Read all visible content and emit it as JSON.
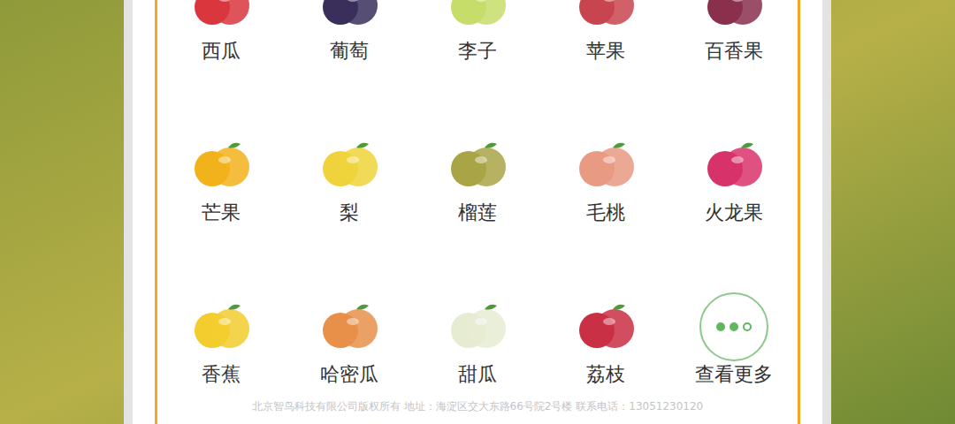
{
  "fruits": [
    {
      "name": "西瓜",
      "kind": "fruit",
      "color": "#d9363e"
    },
    {
      "name": "葡萄",
      "kind": "fruit",
      "color": "#3a2f5b"
    },
    {
      "name": "李子",
      "kind": "fruit",
      "color": "#c6dd6a"
    },
    {
      "name": "苹果",
      "kind": "fruit",
      "color": "#c8454f"
    },
    {
      "name": "百香果",
      "kind": "fruit",
      "color": "#8a2f4c"
    },
    {
      "name": "芒果",
      "kind": "fruit",
      "color": "#f2b21b"
    },
    {
      "name": "梨",
      "kind": "fruit",
      "color": "#f0d33c"
    },
    {
      "name": "榴莲",
      "kind": "fruit",
      "color": "#a9a445"
    },
    {
      "name": "毛桃",
      "kind": "fruit",
      "color": "#e89a82"
    },
    {
      "name": "火龙果",
      "kind": "fruit",
      "color": "#d8326a"
    },
    {
      "name": "香蕉",
      "kind": "fruit",
      "color": "#f3cd2e"
    },
    {
      "name": "哈密瓜",
      "kind": "fruit",
      "color": "#e8904a"
    },
    {
      "name": "甜瓜",
      "kind": "fruit",
      "color": "#e6ecd2"
    },
    {
      "name": "荔枝",
      "kind": "fruit",
      "color": "#c92f45"
    },
    {
      "name": "查看更多",
      "kind": "more"
    }
  ],
  "footer": "北京智鸟科技有限公司版权所有 地址：海淀区交大东路66号院2号楼 联系电话：13051230120"
}
